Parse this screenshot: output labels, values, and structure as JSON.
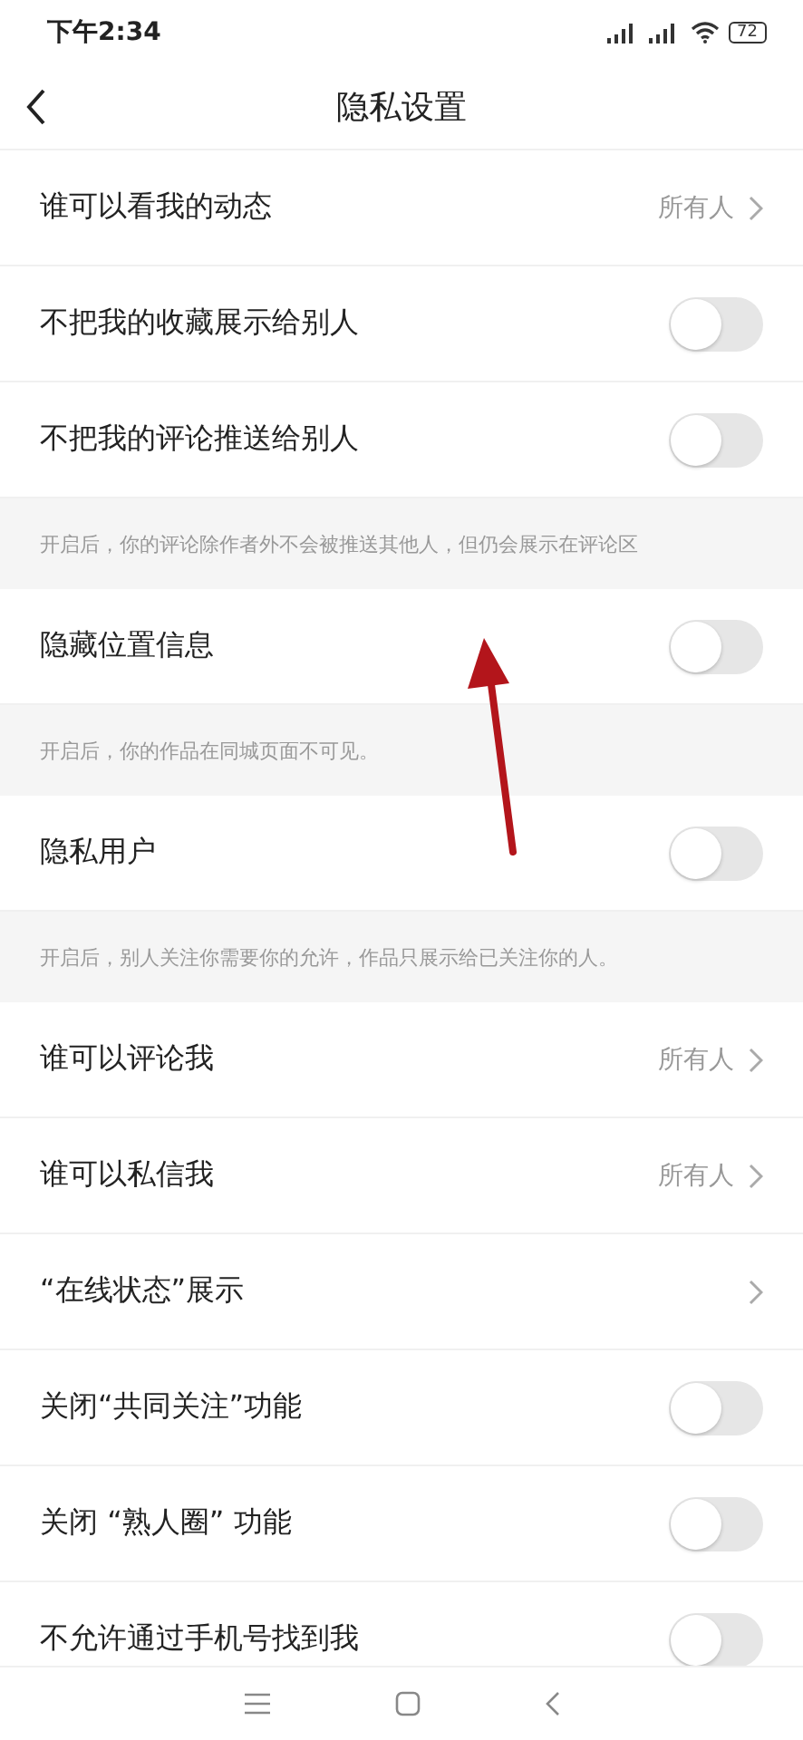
{
  "status_bar": {
    "time": "下午2:34",
    "battery": "72"
  },
  "header": {
    "title": "隐私设置"
  },
  "items": [
    {
      "kind": "link",
      "label": "谁可以看我的动态",
      "value": "所有人"
    },
    {
      "kind": "toggle",
      "label": "不把我的收藏展示给别人",
      "on": false
    },
    {
      "kind": "toggle",
      "label": "不把我的评论推送给别人",
      "on": false
    },
    {
      "kind": "note",
      "text": "开启后，你的评论除作者外不会被推送其他人，但仍会展示在评论区"
    },
    {
      "kind": "toggle",
      "label": "隐藏位置信息",
      "on": false
    },
    {
      "kind": "note",
      "text": "开启后，你的作品在同城页面不可见。"
    },
    {
      "kind": "toggle",
      "label": "隐私用户",
      "on": false
    },
    {
      "kind": "note",
      "text": "开启后，别人关注你需要你的允许，作品只展示给已关注你的人。"
    },
    {
      "kind": "link",
      "label": "谁可以评论我",
      "value": "所有人"
    },
    {
      "kind": "link",
      "label": "谁可以私信我",
      "value": "所有人"
    },
    {
      "kind": "link",
      "label": "“在线状态”展示"
    },
    {
      "kind": "toggle",
      "label": "关闭“共同关注”功能",
      "on": false
    },
    {
      "kind": "toggle",
      "label": "关闭 “熟人圈” 功能",
      "on": false
    },
    {
      "kind": "toggle",
      "label": "不允许通过手机号找到我",
      "on": false
    }
  ],
  "annotations": [
    {
      "kind": "arrow",
      "color": "#b3151b"
    }
  ]
}
